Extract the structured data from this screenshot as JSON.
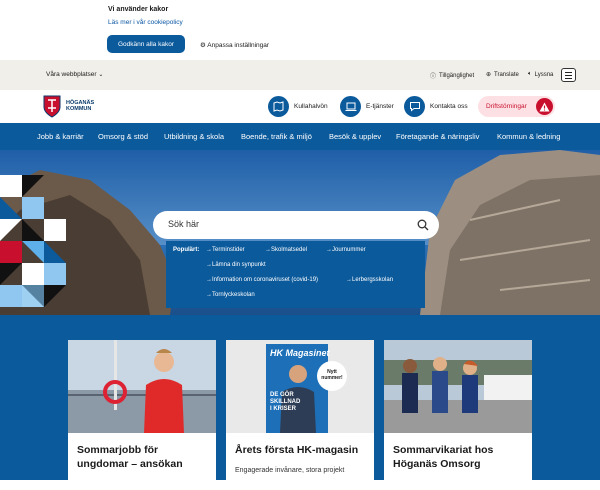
{
  "cookie": {
    "title": "Vi använder kakor",
    "link": "Läs mer i vår cookiepolicy",
    "accept": "Godkänn alla kakor",
    "settings": "Anpassa inställningar"
  },
  "utility": {
    "sites": "Våra webbplatser",
    "accessibility": "Tillgänglighet",
    "translate": "Translate",
    "listen": "Lyssna"
  },
  "logo": {
    "line1": "HÖGANÄS",
    "line2": "KOMMUN"
  },
  "header_buttons": [
    {
      "label": "Kullahalvön",
      "icon": "map-icon"
    },
    {
      "label": "E-tjänster",
      "icon": "laptop-icon"
    },
    {
      "label": "Kontakta oss",
      "icon": "chat-icon"
    }
  ],
  "alert": {
    "label": "Driftstörningar"
  },
  "nav": [
    "Jobb & karriär",
    "Omsorg & stöd",
    "Utbildning & skola",
    "Boende, trafik & miljö",
    "Besök & upplev",
    "Företagande & näringsliv",
    "Kommun & ledning"
  ],
  "search": {
    "placeholder": "Sök här",
    "popular_label": "Populärt:",
    "popular": [
      "Terminstider",
      "Skolmatsedel",
      "Journummer",
      "Lämna din synpunkt",
      "Information om coronaviruset (covid-19)",
      "Lerbergsskolan",
      "Tornlyckeskolan"
    ]
  },
  "cards": [
    {
      "title_l1": "Sommarjobb för",
      "title_l2": "ungdomar – ansökan",
      "subtitle": ""
    },
    {
      "title_l1": "Årets första HK-magasin",
      "title_l2": "",
      "subtitle": "Engagerade invånare, stora projekt",
      "badge_l1": "Nytt",
      "badge_l2": "nummer!",
      "mag_title": "HK Magasinet",
      "mag_caption_l1": "DE GÖR",
      "mag_caption_l2": "SKILLNAD",
      "mag_caption_l3": "I KRISER"
    },
    {
      "title_l1": "Sommarvikariat hos",
      "title_l2": "Höganäs Omsorg",
      "subtitle": ""
    }
  ],
  "colors": {
    "brand": "#0b5a9c",
    "alert": "#c8102e"
  }
}
